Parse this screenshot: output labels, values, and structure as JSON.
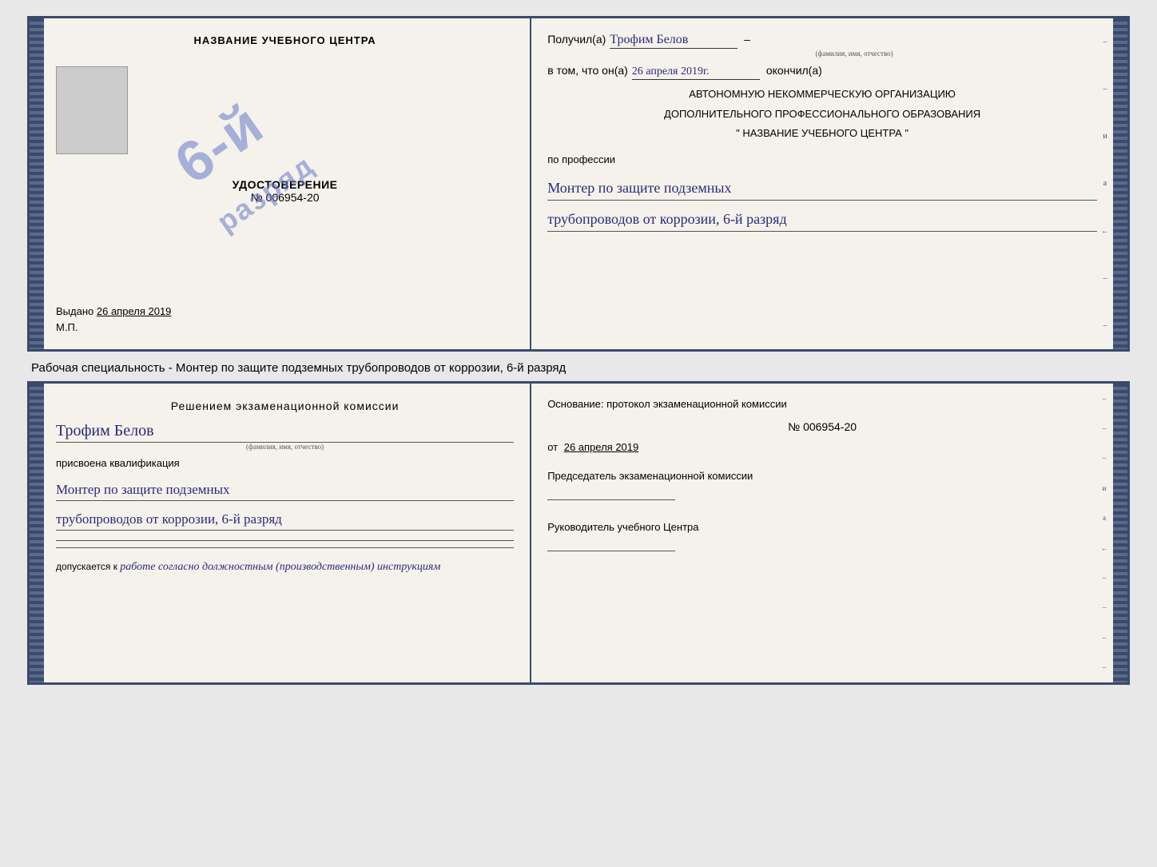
{
  "cert_top": {
    "left_title": "НАЗВАНИЕ УЧЕБНОГО ЦЕНТРА",
    "udost_label": "УДОСТОВЕРЕНИЕ",
    "cert_number": "№ 006954-20",
    "stamp": {
      "line1": "6-й",
      "line2": "разряд"
    },
    "issued_date_label": "Выдано",
    "issued_date": "26 апреля 2019",
    "mp_label": "М.П."
  },
  "cert_right": {
    "received_label": "Получил(а)",
    "recipient_name": "Трофим Белов",
    "name_subtitle": "(фамилия, имя, отчество)",
    "in_that_label": "в том, что он(а)",
    "date_handwritten": "26 апреля 2019г.",
    "finished_label": "окончил(а)",
    "org_line1": "АВТОНОМНУЮ НЕКОММЕРЧЕСКУЮ ОРГАНИЗАЦИЮ",
    "org_line2": "ДОПОЛНИТЕЛЬНОГО ПРОФЕССИОНАЛЬНОГО ОБРАЗОВАНИЯ",
    "org_name": "\" НАЗВАНИЕ УЧЕБНОГО ЦЕНТРА \"",
    "profession_label": "по профессии",
    "profession_line1": "Монтер по защите подземных",
    "profession_line2": "трубопроводов от коррозии, 6-й разряд"
  },
  "specialty_text": "Рабочая специальность - Монтер по защите подземных трубопроводов от коррозии, 6-й разряд",
  "cert_bottom_left": {
    "decision_title": "Решением экзаменационной комиссии",
    "recipient_name": "Трофим Белов",
    "name_subtitle": "(фамилия, имя, отчество)",
    "qualification_label": "присвоена квалификация",
    "qualification_line1": "Монтер по защите подземных",
    "qualification_line2": "трубопроводов от коррозии, 6-й разряд",
    "allowed_label": "допускается к",
    "allowed_text": "работе согласно должностным (производственным) инструкциям"
  },
  "cert_bottom_right": {
    "basis_label": "Основание: протокол экзаменационной комиссии",
    "number_label": "№ 006954-20",
    "from_label": "от",
    "from_date": "26 апреля 2019",
    "chairman_label": "Председатель экзаменационной комиссии",
    "head_label": "Руководитель учебного Центра"
  }
}
